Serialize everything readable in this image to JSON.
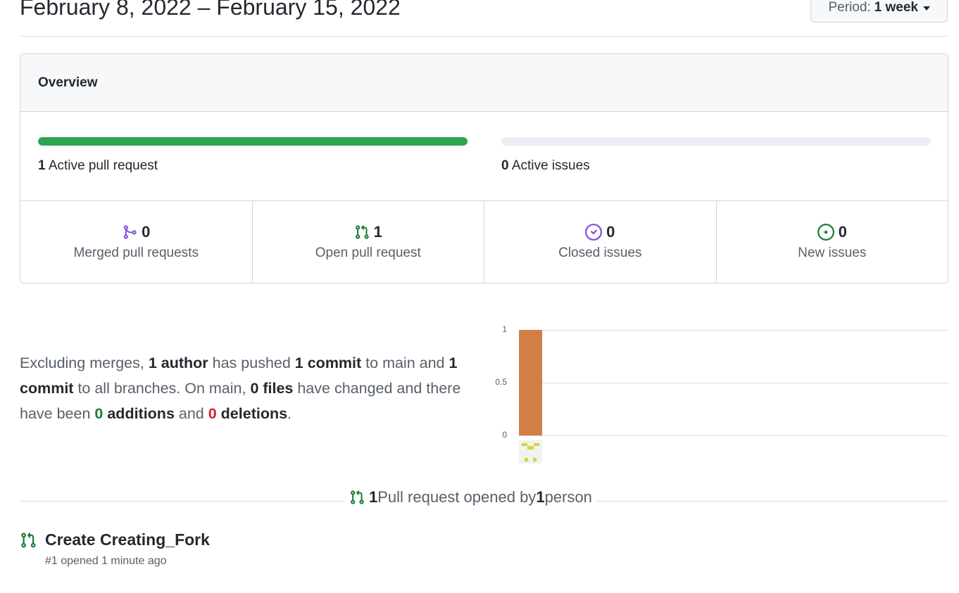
{
  "header": {
    "date_range": "February 8, 2022 – February 15, 2022",
    "period_label": "Period:",
    "period_value": "1 week"
  },
  "overview": {
    "title": "Overview",
    "pull_requests_bar": {
      "count": "1",
      "label": "Active pull request",
      "fill_fraction": 1.0,
      "color": "#2da44e"
    },
    "issues_bar": {
      "count": "0",
      "label": "Active issues",
      "fill_fraction": 0.0
    },
    "stats": [
      {
        "icon": "git-merge-icon",
        "value": "0",
        "label": "Merged pull requests",
        "color": "#8250df"
      },
      {
        "icon": "git-pull-request-icon",
        "value": "1",
        "label": "Open pull request",
        "color": "#1a7f37"
      },
      {
        "icon": "issue-closed-icon",
        "value": "0",
        "label": "Closed issues",
        "color": "#8250df"
      },
      {
        "icon": "issue-opened-icon",
        "value": "0",
        "label": "New issues",
        "color": "#1a7f37"
      }
    ]
  },
  "summary": {
    "t1": "Excluding merges, ",
    "authors": "1 author",
    "t2": " has pushed ",
    "commits_main": "1 commit",
    "t3": " to main and ",
    "commits_all": "1 commit",
    "t4": " to all branches. On main, ",
    "files": "0 files",
    "t5": " have changed and there have been ",
    "additions_count": "0",
    "additions_word": " additions",
    "t6": " and ",
    "deletions_count": "0",
    "deletions_word": " deletions",
    "t7": "."
  },
  "chart_data": {
    "type": "bar",
    "categories": [
      ""
    ],
    "values": [
      1
    ],
    "yticks": [
      "1",
      "0.5",
      "0"
    ],
    "ylim": [
      0,
      1
    ],
    "bar_color": "#d27f45"
  },
  "pull_requests": {
    "count": "1",
    "t1": " Pull request opened by ",
    "people": "1",
    "t2": " person",
    "items": [
      {
        "title": "Create Creating_Fork",
        "meta": "#1 opened 1 minute ago"
      }
    ]
  }
}
